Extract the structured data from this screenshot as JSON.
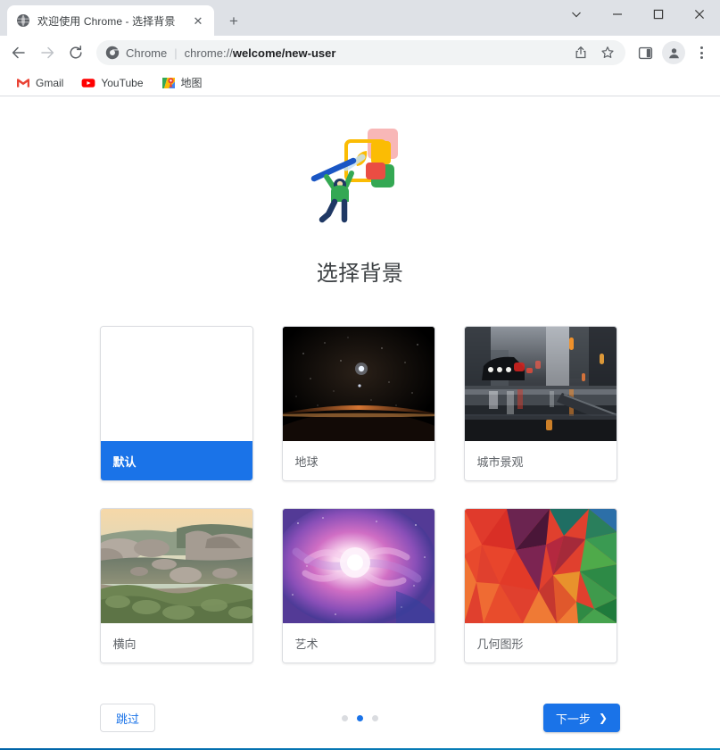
{
  "window": {
    "controls": [
      {
        "name": "tab-search",
        "glyph": "chevron-down"
      },
      {
        "name": "minimize",
        "glyph": "minimize"
      },
      {
        "name": "maximize",
        "glyph": "maximize"
      },
      {
        "name": "close",
        "glyph": "close"
      }
    ]
  },
  "tabs": [
    {
      "title": "欢迎使用 Chrome - 选择背景",
      "favicon": "globe-icon",
      "close_label": "✕",
      "active": true
    }
  ],
  "newtab": {
    "label": "+"
  },
  "toolbar": {
    "back_label": "←",
    "forward_label": "→",
    "reload_label": "⟳",
    "omnibox": {
      "chip": "Chrome",
      "separator": "|",
      "url_scheme": "chrome://",
      "url_rest": "welcome/new-user",
      "full_url": "chrome://welcome/new-user"
    },
    "actions": [
      {
        "name": "share-icon",
        "label": "share"
      },
      {
        "name": "bookmark-star-icon",
        "label": "star"
      },
      {
        "name": "side-panel-icon",
        "label": "side panel"
      },
      {
        "name": "profile-avatar",
        "label": "profile"
      },
      {
        "name": "chrome-menu-icon",
        "label": "more"
      }
    ]
  },
  "bookmarks": [
    {
      "label": "Gmail",
      "icon": "gmail-icon"
    },
    {
      "label": "YouTube",
      "icon": "youtube-icon"
    },
    {
      "label": "地图",
      "icon": "google-maps-icon"
    }
  ],
  "content": {
    "illustration": "person-painting-illustration",
    "title": "选择背景",
    "cards": [
      {
        "label": "默认",
        "thumb": "blank",
        "selected": true
      },
      {
        "label": "地球",
        "thumb": "earth",
        "selected": false
      },
      {
        "label": "城市景观",
        "thumb": "cityscape",
        "selected": false
      },
      {
        "label": "横向",
        "thumb": "landscape",
        "selected": false
      },
      {
        "label": "艺术",
        "thumb": "art",
        "selected": false
      },
      {
        "label": "几何图形",
        "thumb": "geometric",
        "selected": false
      }
    ],
    "footer": {
      "skip_label": "跳过",
      "next_label": "下一步",
      "next_chevron": "❯",
      "step_dots": 3,
      "active_dot": 1
    }
  },
  "colors": {
    "accent": "#1a73e8",
    "tabstrip": "#dee1e6",
    "omnibox_bg": "#f1f3f4",
    "text_primary": "#3c4043",
    "text_secondary": "#5f6368",
    "border": "#dadce0",
    "taskbar": "#0063a8"
  }
}
